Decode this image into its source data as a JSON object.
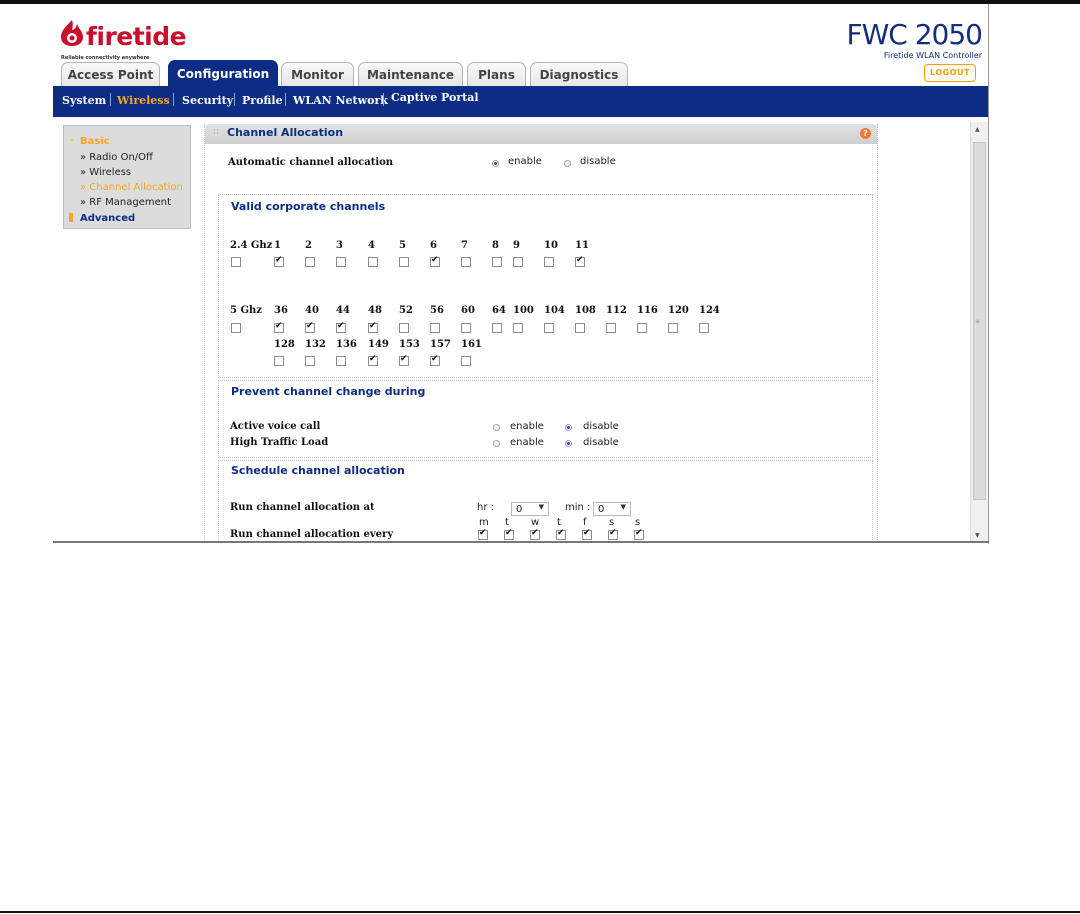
{
  "brand": {
    "logo_text": "firetide",
    "tagline": "Reliable connectivity anywhere",
    "product_name": "FWC 2050",
    "product_subtitle": "Firetide WLAN Controller",
    "logout_label": "LOGOUT"
  },
  "tabs": [
    "Access Point",
    "Configuration",
    "Monitor",
    "Maintenance",
    "Plans",
    "Diagnostics"
  ],
  "subnav": [
    "System",
    "Wireless",
    "Security",
    "Profile",
    "WLAN Network",
    "Captive Portal"
  ],
  "leftmenu": {
    "basic": "Basic",
    "items": [
      "» Radio On/Off",
      "» Wireless",
      "» Channel Allocation",
      "» RF Management"
    ],
    "advanced": "Advanced"
  },
  "panel": {
    "title": "Channel Allocation",
    "auto_label": "Automatic channel allocation",
    "enable": "enable",
    "disable": "disable",
    "auto_value": "enable"
  },
  "valid_channels": {
    "title": "Valid corporate channels",
    "band24_label": "2.4 Ghz",
    "band24": [
      {
        "ch": "1",
        "on": true
      },
      {
        "ch": "2",
        "on": false
      },
      {
        "ch": "3",
        "on": false
      },
      {
        "ch": "4",
        "on": false
      },
      {
        "ch": "5",
        "on": false
      },
      {
        "ch": "6",
        "on": true
      },
      {
        "ch": "7",
        "on": false
      },
      {
        "ch": "8",
        "on": false
      },
      {
        "ch": "9",
        "on": false
      },
      {
        "ch": "10",
        "on": false
      },
      {
        "ch": "11",
        "on": true
      }
    ],
    "band5_label": "5 Ghz",
    "band5_row1": [
      {
        "ch": "36",
        "on": true
      },
      {
        "ch": "40",
        "on": true
      },
      {
        "ch": "44",
        "on": true
      },
      {
        "ch": "48",
        "on": true
      },
      {
        "ch": "52",
        "on": false
      },
      {
        "ch": "56",
        "on": false
      },
      {
        "ch": "60",
        "on": false
      },
      {
        "ch": "64",
        "on": false
      },
      {
        "ch": "100",
        "on": false
      },
      {
        "ch": "104",
        "on": false
      },
      {
        "ch": "108",
        "on": false
      },
      {
        "ch": "112",
        "on": false
      },
      {
        "ch": "116",
        "on": false
      },
      {
        "ch": "120",
        "on": false
      },
      {
        "ch": "124",
        "on": false
      }
    ],
    "band5_row2": [
      {
        "ch": "128",
        "on": false
      },
      {
        "ch": "132",
        "on": false
      },
      {
        "ch": "136",
        "on": false
      },
      {
        "ch": "149",
        "on": true
      },
      {
        "ch": "153",
        "on": true
      },
      {
        "ch": "157",
        "on": true
      },
      {
        "ch": "161",
        "on": false
      }
    ]
  },
  "prevent": {
    "title": "Prevent channel change during",
    "voice_label": "Active voice call",
    "voice_value": "disable",
    "traffic_label": "High Traffic Load",
    "traffic_value": "disable"
  },
  "schedule": {
    "title": "Schedule channel allocation",
    "run_at_label": "Run channel allocation at",
    "hr_label": "hr :",
    "hr_value": "0",
    "min_label": "min :",
    "min_value": "0",
    "run_every_label": "Run channel allocation every",
    "days": [
      {
        "d": "m",
        "on": true
      },
      {
        "d": "t",
        "on": true
      },
      {
        "d": "w",
        "on": true
      },
      {
        "d": "t",
        "on": true
      },
      {
        "d": "f",
        "on": true
      },
      {
        "d": "s",
        "on": true
      },
      {
        "d": "s",
        "on": true
      }
    ]
  },
  "colors": {
    "navy": "#0c2d83",
    "accent": "#f5a623",
    "brand_red": "#c8102e"
  }
}
